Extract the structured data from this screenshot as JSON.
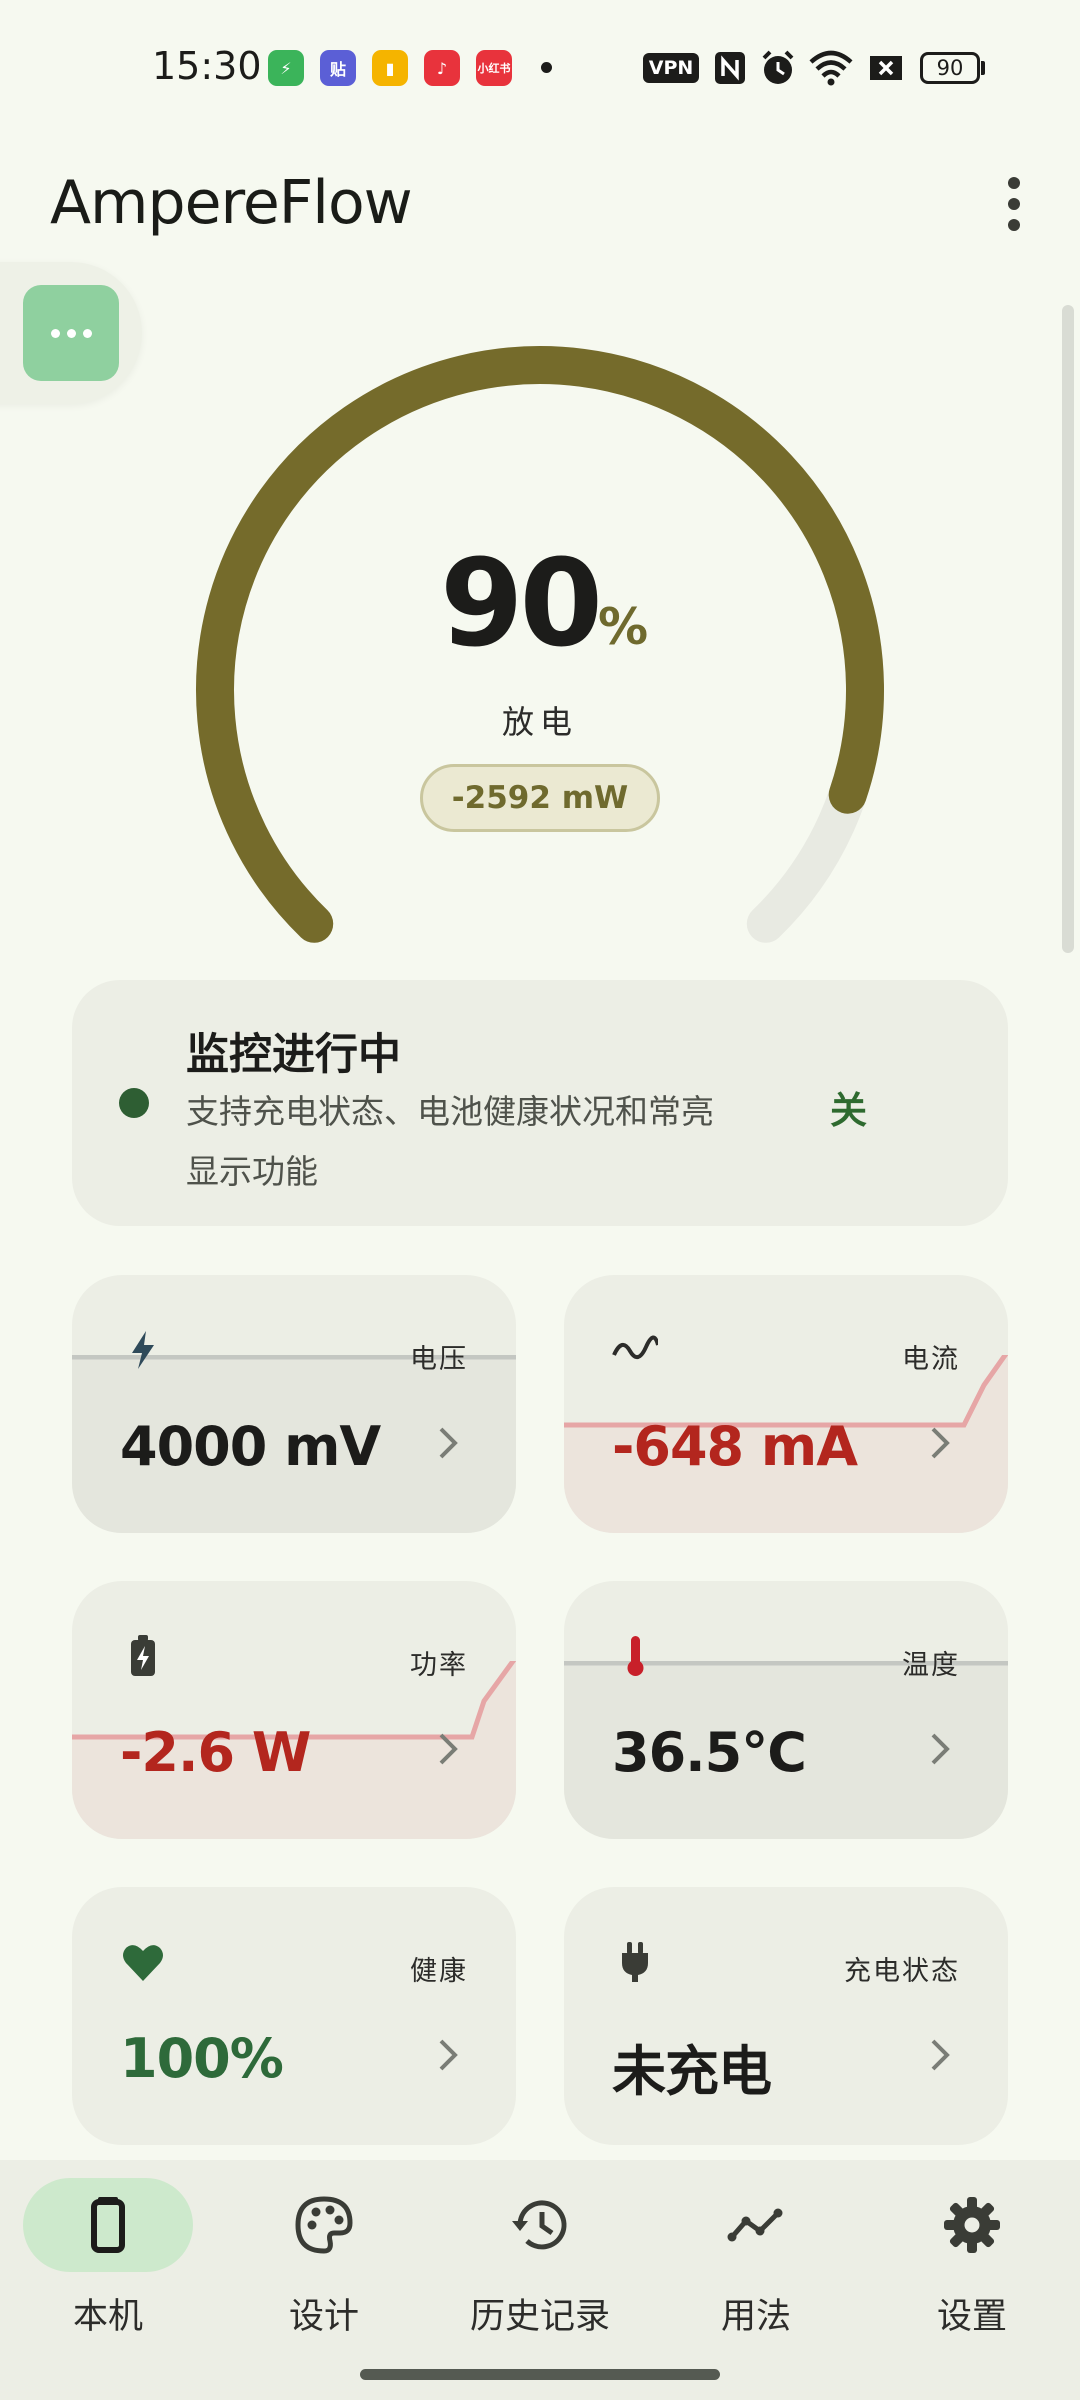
{
  "status_bar": {
    "time": "15:30",
    "app_icons": [
      {
        "name": "shield-app-icon",
        "glyph": "⚡",
        "color": "#3bb45a"
      },
      {
        "name": "tieba-app-icon",
        "glyph": "贴",
        "color": "#5b5fd6"
      },
      {
        "name": "books-app-icon",
        "glyph": "▮",
        "color": "#f5b400"
      },
      {
        "name": "music-app-icon",
        "glyph": "♪",
        "color": "#e8333c"
      },
      {
        "name": "xiaohongshu-app-icon",
        "glyph": "小红书",
        "color": "#e8333c"
      }
    ],
    "vpn": "VPN",
    "battery": "90"
  },
  "app_bar": {
    "title": "AmpereFlow"
  },
  "gauge": {
    "percent": "90",
    "percent_fraction": 0.9,
    "unit": "%",
    "state": "放电",
    "power": "-2592 mW",
    "colors": {
      "arc": "#756b2b",
      "track": "#e8eae2"
    }
  },
  "monitor": {
    "title": "监控进行中",
    "description": "支持充电状态、电池健康状况和常亮显示功能",
    "toggle": "关"
  },
  "metrics": [
    {
      "id": "voltage",
      "label": "电压",
      "value": "4000 mV",
      "icon": "bolt-icon",
      "value_color": "default"
    },
    {
      "id": "current",
      "label": "电流",
      "value": "-648 mA",
      "icon": "wave-icon",
      "value_color": "red"
    },
    {
      "id": "power",
      "label": "功率",
      "value": "-2.6 W",
      "icon": "battery-charging-icon",
      "value_color": "red"
    },
    {
      "id": "temperature",
      "label": "温度",
      "value": "36.5°C",
      "icon": "thermometer-icon",
      "value_color": "default"
    },
    {
      "id": "health",
      "label": "健康",
      "value": "100%",
      "icon": "heart-icon",
      "value_color": "green"
    },
    {
      "id": "charging",
      "label": "充电状态",
      "value": "未充电",
      "icon": "plug-icon",
      "value_color": "default"
    }
  ],
  "nav": {
    "items": [
      {
        "label": "本机",
        "icon": "phone-battery-icon",
        "active": true
      },
      {
        "label": "设计",
        "icon": "palette-icon",
        "active": false
      },
      {
        "label": "历史记录",
        "icon": "history-icon",
        "active": false
      },
      {
        "label": "用法",
        "icon": "trend-icon",
        "active": false
      },
      {
        "label": "设置",
        "icon": "gear-icon",
        "active": false
      }
    ]
  }
}
